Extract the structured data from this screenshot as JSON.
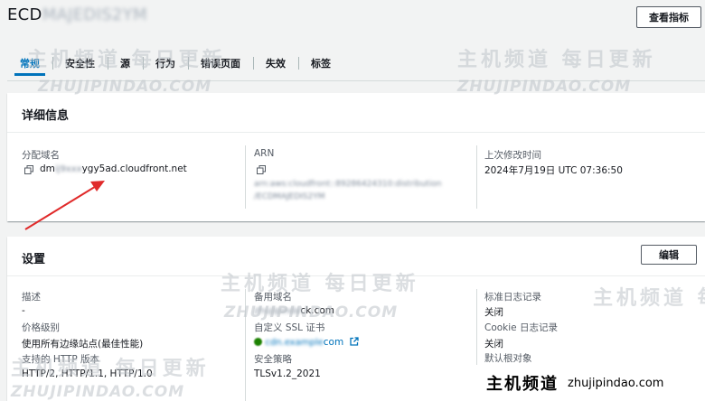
{
  "header": {
    "title_prefix": "ECD",
    "title_blurred": "MAJEDIS2YM",
    "metrics_button": "查看指标"
  },
  "tabs": [
    {
      "label": "常规",
      "active": true
    },
    {
      "label": "安全性",
      "active": false
    },
    {
      "label": "源",
      "active": false
    },
    {
      "label": "行为",
      "active": false
    },
    {
      "label": "错误页面",
      "active": false
    },
    {
      "label": "失效",
      "active": false
    },
    {
      "label": "标签",
      "active": false
    }
  ],
  "details": {
    "title": "详细信息",
    "domain_label": "分配域名",
    "domain_value_prefix": "dm",
    "domain_value_blurred": "ij9xxx",
    "domain_value_suffix": "ygy5ad.cloudfront.net",
    "arn_label": "ARN",
    "arn_line1": "arn:aws:cloudfront::89286424310:distribution",
    "arn_line2": "/ECDMAJEDIS2YM",
    "modified_label": "上次修改时间",
    "modified_value": "2024年7月19日 UTC 07:36:50"
  },
  "settings": {
    "title": "设置",
    "edit_button": "编辑",
    "description_label": "描述",
    "description_value": "-",
    "price_class_label": "价格级别",
    "price_class_value": "使用所有边缘站点(最佳性能)",
    "http_label": "支持的 HTTP 版本",
    "http_value": "HTTP/2, HTTP/1.1, HTTP/1.0",
    "alt_domain_label": "备用域名",
    "alt_domain_blurred": "zhujipinda",
    "alt_domain_suffix": "ck.com",
    "ssl_label": "自定义 SSL 证书",
    "ssl_blurred": "cdn.example",
    "ssl_suffix": "com",
    "security_policy_label": "安全策略",
    "security_policy_value": "TLSv1.2_2021",
    "std_log_label": "标准日志记录",
    "std_log_value": "关闭",
    "cookie_log_label": "Cookie 日志记录",
    "cookie_log_value": "关闭",
    "default_root_label": "默认根对象"
  },
  "watermark": {
    "cn": "主机频道 每日更新",
    "en": "ZHUJIPINDAO.COM"
  },
  "brand": {
    "cn": "主机频道",
    "en": "zhujipindao.com"
  },
  "colors": {
    "accent": "#0073bb",
    "arrow": "#e02a2a"
  }
}
